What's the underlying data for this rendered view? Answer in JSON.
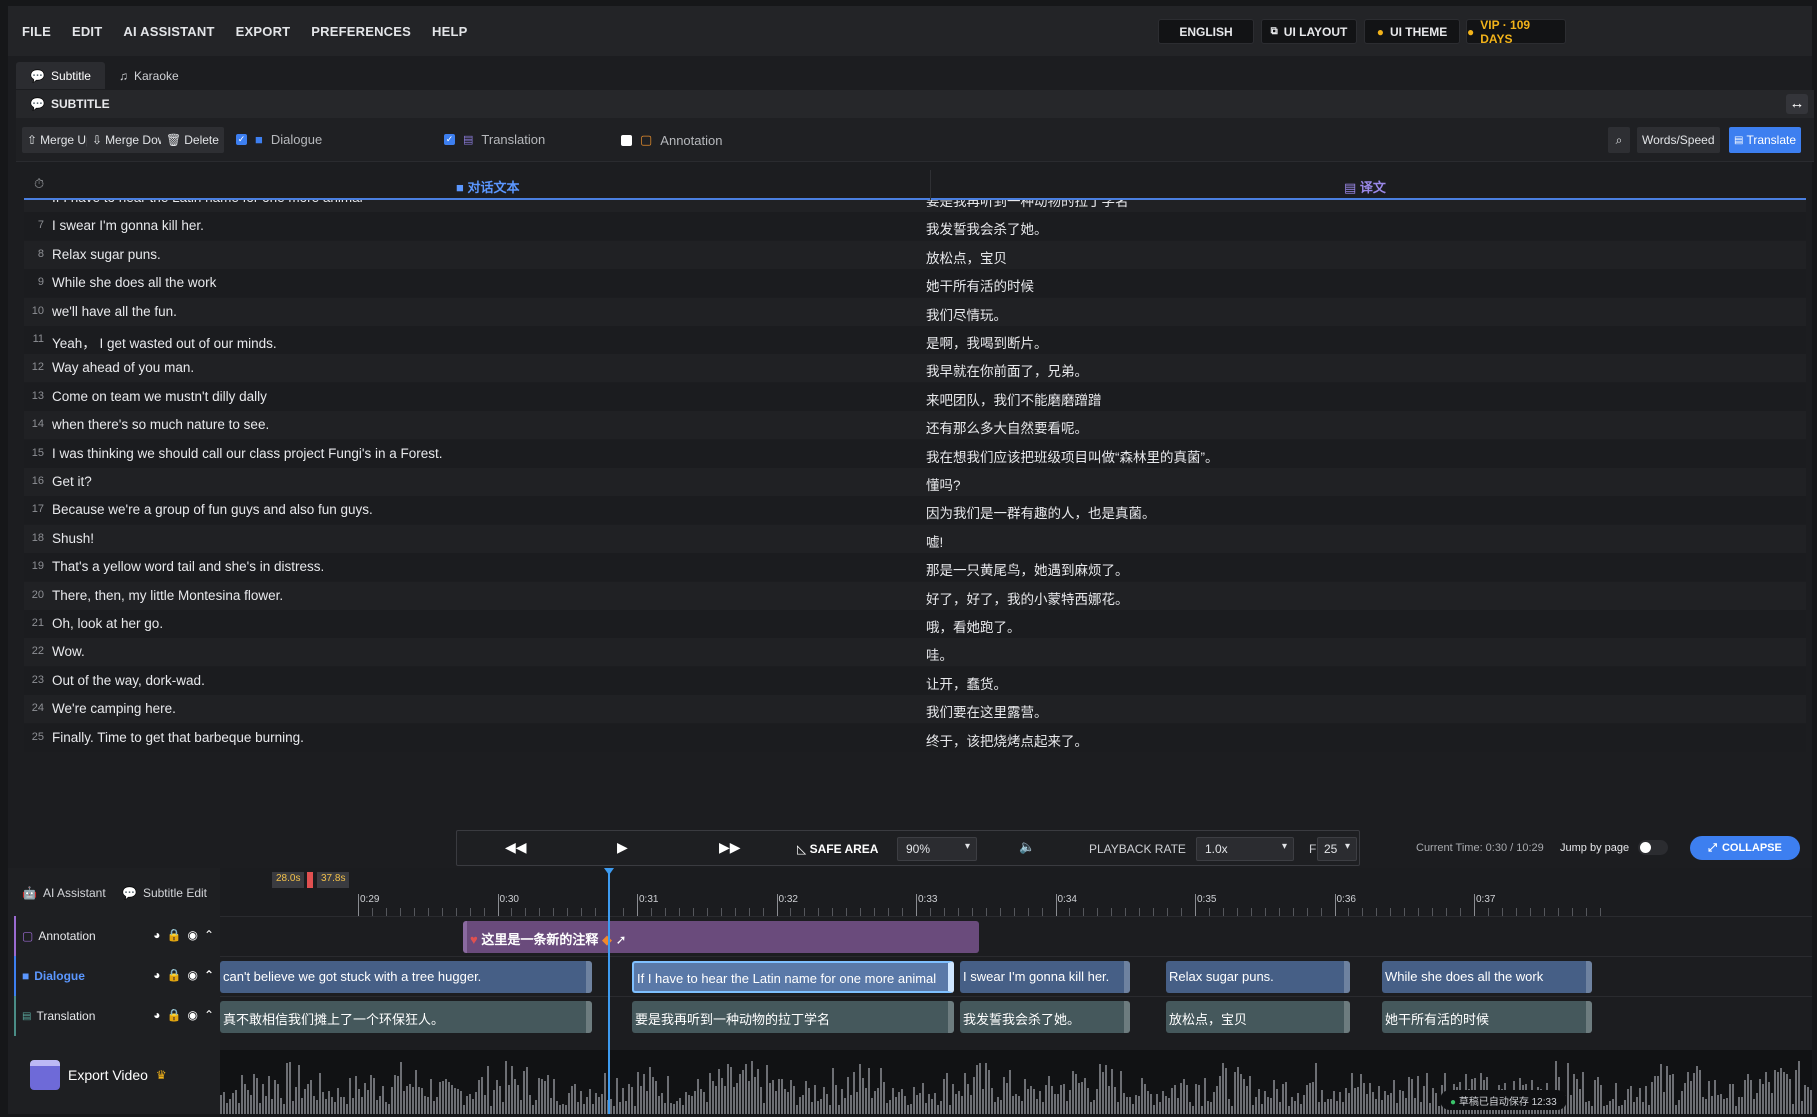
{
  "menu": [
    "FILE",
    "EDIT",
    "AI ASSISTANT",
    "EXPORT",
    "PREFERENCES",
    "HELP"
  ],
  "top": {
    "language": "ENGLISH",
    "layout": "UI LAYOUT",
    "theme": "UI THEME",
    "vip": "VIP · 109 DAYS"
  },
  "tabs": [
    "Subtitle",
    "Karaoke"
  ],
  "section": "SUBTITLE",
  "toolbar": {
    "merge_up": "Merge Up",
    "merge_down": "Merge Down",
    "delete": "Delete",
    "dialogue": "Dialogue",
    "translation": "Translation",
    "annotation": "Annotation",
    "words_speed": "Words/Speed",
    "translate": "Translate"
  },
  "columns": {
    "dialogue": "对话文本",
    "translation": "译文"
  },
  "rows": [
    {
      "n": "",
      "d": "If I have to hear the Latin name for one more animal",
      "t": "要是我再听到一种动物的拉丁学名"
    },
    {
      "n": "7",
      "d": "I swear I'm gonna kill her.",
      "t": "我发誓我会杀了她。"
    },
    {
      "n": "8",
      "d": "Relax sugar puns.",
      "t": "放松点，宝贝"
    },
    {
      "n": "9",
      "d": "While she does all the work",
      "t": "她干所有活的时候"
    },
    {
      "n": "10",
      "d": "we'll have all the fun.",
      "t": "我们尽情玩。"
    },
    {
      "n": "11",
      "d": "Yeah， I get wasted out of our minds.",
      "t": "是啊，我喝到断片。"
    },
    {
      "n": "12",
      "d": "Way ahead of you man.",
      "t": "我早就在你前面了，兄弟。"
    },
    {
      "n": "13",
      "d": "Come on team we mustn't dilly dally",
      "t": "来吧团队，我们不能磨磨蹭蹭"
    },
    {
      "n": "14",
      "d": "when there's so much nature to see.",
      "t": "还有那么多大自然要看呢。"
    },
    {
      "n": "15",
      "d": "I was thinking we should call our class project Fungi's in a Forest.",
      "t": "我在想我们应该把班级项目叫做“森林里的真菌”。"
    },
    {
      "n": "16",
      "d": "Get it?",
      "t": "懂吗?"
    },
    {
      "n": "17",
      "d": "Because we're a group of fun guys and also fun guys.",
      "t": "因为我们是一群有趣的人，也是真菌。"
    },
    {
      "n": "18",
      "d": "Shush!",
      "t": "嘘!"
    },
    {
      "n": "19",
      "d": "That's a yellow word tail and she's in distress.",
      "t": "那是一只黄尾鸟，她遇到麻烦了。"
    },
    {
      "n": "20",
      "d": "There, then, my little Montesina flower.",
      "t": "好了，好了，我的小蒙特西娜花。"
    },
    {
      "n": "21",
      "d": "Oh, look at her go.",
      "t": "哦，看她跑了。"
    },
    {
      "n": "22",
      "d": "Wow.",
      "t": "哇。"
    },
    {
      "n": "23",
      "d": "Out of the way, dork-wad.",
      "t": "让开，蠢货。"
    },
    {
      "n": "24",
      "d": "We're camping here.",
      "t": "我们要在这里露营。"
    },
    {
      "n": "25",
      "d": "Finally. Time to get that barbeque burning.",
      "t": "终于，该把烧烤点起来了。"
    }
  ],
  "controls": {
    "safe_area": "SAFE AREA",
    "safe_value": "90%",
    "playback_rate": "PLAYBACK RATE",
    "rate_value": "1.0x",
    "fps": "FPS",
    "fps_value": "25",
    "current_time": "Current Time: 0:30 / 10:29",
    "jump": "Jump by page",
    "collapse": "COLLAPSE"
  },
  "timeline": {
    "ai_assistant": "AI Assistant",
    "subtitle_edit": "Subtitle Edit",
    "marker_a": "28.0s",
    "marker_b": "37.8s",
    "ticks": [
      "0:29",
      "0:30",
      "0:31",
      "0:32",
      "0:33",
      "0:34",
      "0:35",
      "0:36",
      "0:37"
    ],
    "tracks": {
      "annotation": "Annotation",
      "dialogue": "Dialogue",
      "translation": "Translation"
    },
    "annotation_clip": "这里是一条新的注释",
    "dialogue_clips": [
      "can't believe we got stuck with a tree hugger.",
      "If I have to hear the Latin name for one more animal",
      "I swear I'm gonna kill her.",
      "Relax sugar puns.",
      "While she does all the work"
    ],
    "translation_clips": [
      "真不敢相信我们摊上了一个环保狂人。",
      "要是我再听到一种动物的拉丁学名",
      "我发誓我会杀了她。",
      "放松点，宝贝",
      "她干所有活的时候"
    ],
    "export": "Export Video",
    "autosave": "草稿已自动保存 12:33"
  },
  "colors": {
    "accent": "#3d7ff0",
    "dialogue": "#465f86",
    "translation": "#45585c",
    "annotation": "#6a4b7c"
  }
}
